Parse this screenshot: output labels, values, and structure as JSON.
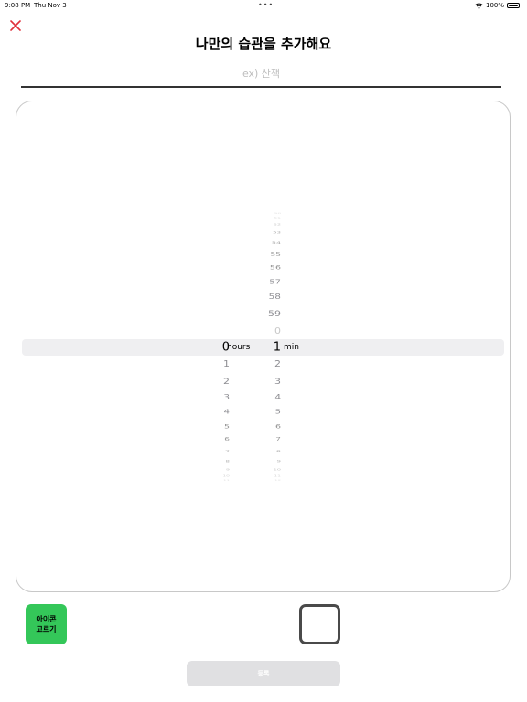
{
  "status_bar": {
    "time": "9:08 PM",
    "date": "Thu Nov 3",
    "dots": "•••",
    "battery": "100%"
  },
  "header": {
    "title": "나만의 습관을 추가해요"
  },
  "name_input": {
    "placeholder": "ex) 산책",
    "value": ""
  },
  "picker": {
    "hours_label": "hours",
    "minutes_label": "min",
    "selected_hours": "0",
    "selected_minutes": "1",
    "hours_below": [
      "1",
      "2",
      "3",
      "4",
      "5",
      "6",
      "7",
      "8",
      "9",
      "10",
      "11"
    ],
    "minutes_above": [
      "50",
      "51",
      "52",
      "53",
      "54",
      "55",
      "56",
      "57",
      "58",
      "59",
      "0"
    ],
    "minutes_below": [
      "2",
      "3",
      "4",
      "5",
      "6",
      "7",
      "8",
      "9",
      "10",
      "11",
      "12"
    ]
  },
  "icon_button": {
    "line1": "아이콘",
    "line2": "고르기"
  },
  "submit_button": {
    "label": "등록"
  },
  "colors": {
    "accent_green": "#34c759",
    "close_red": "#e0303a",
    "disabled_button": "#e0e0e2"
  }
}
